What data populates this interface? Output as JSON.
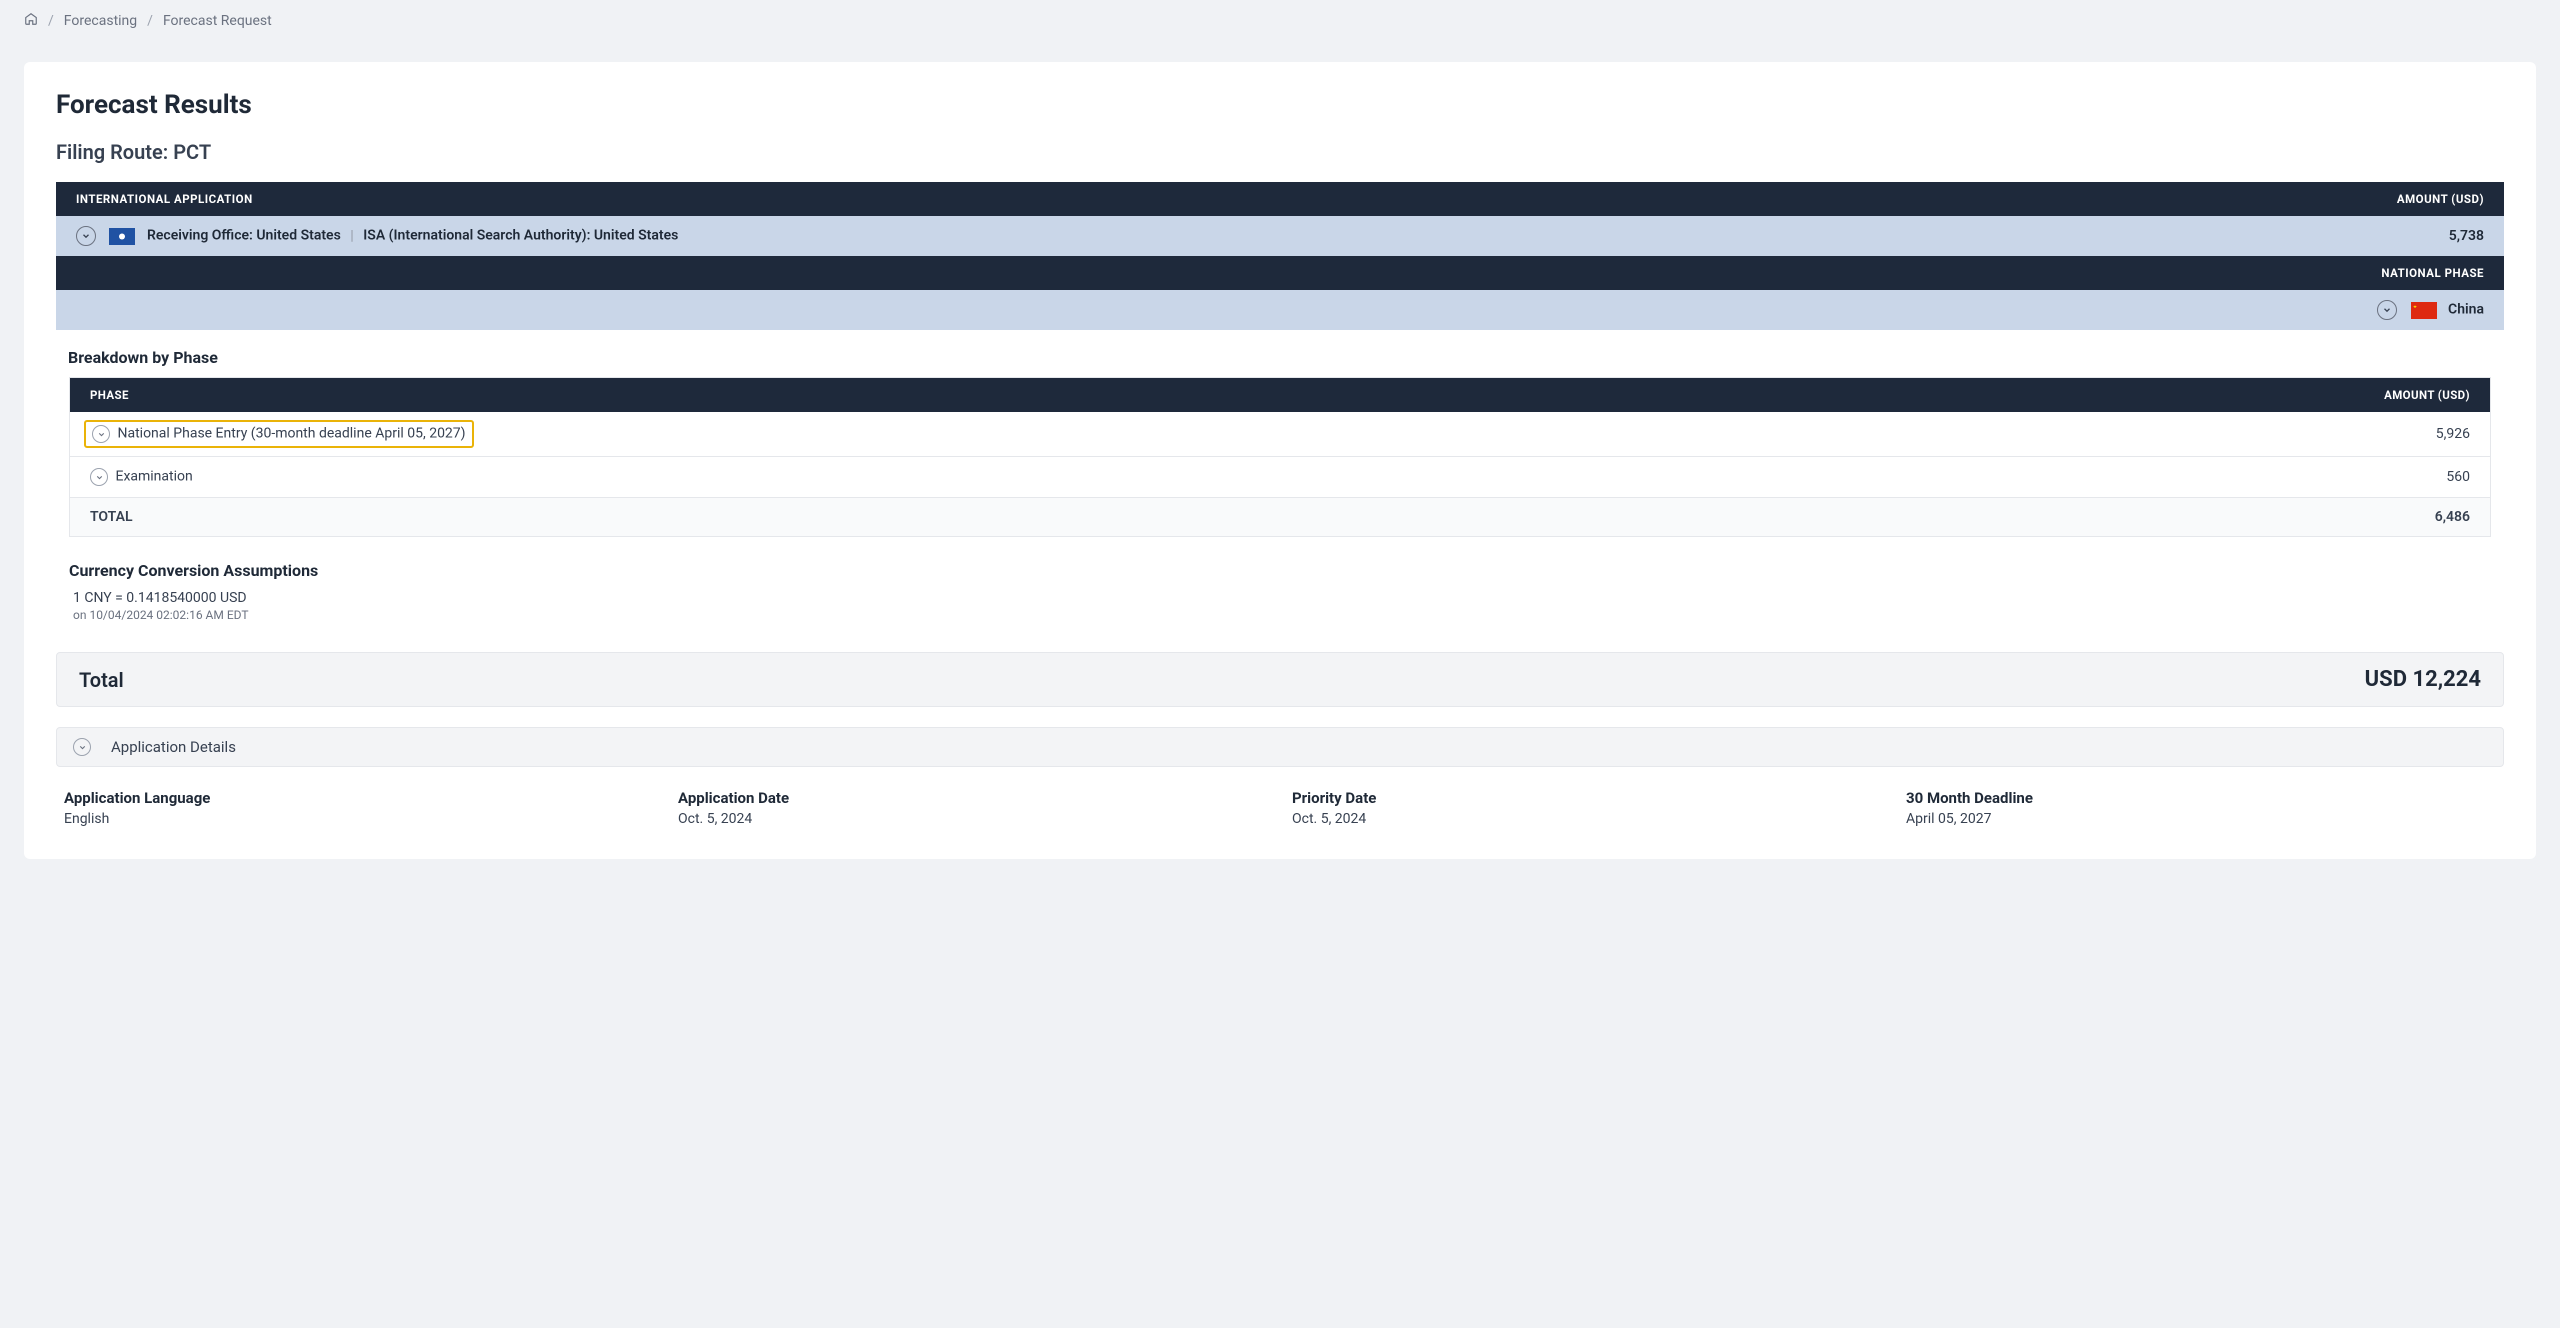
{
  "breadcrumb": {
    "forecasting": "Forecasting",
    "current": "Forecast Request"
  },
  "page": {
    "title": "Forecast Results",
    "filingRoute": "Filing Route: PCT"
  },
  "intlApp": {
    "headerLeft": "INTERNATIONAL APPLICATION",
    "headerRight": "AMOUNT (USD)",
    "receivingOffice": "Receiving Office: United States",
    "isa": "ISA (International Search Authority): United States",
    "amount": "5,738"
  },
  "natPhase": {
    "header": "NATIONAL PHASE",
    "country": "China"
  },
  "breakdown": {
    "title": "Breakdown by Phase",
    "colPhase": "PHASE",
    "colAmount": "AMOUNT (USD)",
    "rows": [
      {
        "label": "National Phase Entry (30-month deadline April 05, 2027)",
        "amount": "5,926",
        "highlighted": true
      },
      {
        "label": "Examination",
        "amount": "560",
        "highlighted": false
      }
    ],
    "totalLabel": "TOTAL",
    "totalAmount": "6,486"
  },
  "currency": {
    "title": "Currency Conversion Assumptions",
    "line": "1 CNY = 0.1418540000 USD",
    "date": "on 10/04/2024 02:02:16 AM EDT"
  },
  "total": {
    "label": "Total",
    "value": "USD 12,224"
  },
  "appDetails": {
    "title": "Application Details",
    "items": [
      {
        "label": "Application Language",
        "value": "English"
      },
      {
        "label": "Application Date",
        "value": "Oct. 5, 2024"
      },
      {
        "label": "Priority Date",
        "value": "Oct. 5, 2024"
      },
      {
        "label": "30 Month Deadline",
        "value": "April 05, 2027"
      }
    ]
  }
}
